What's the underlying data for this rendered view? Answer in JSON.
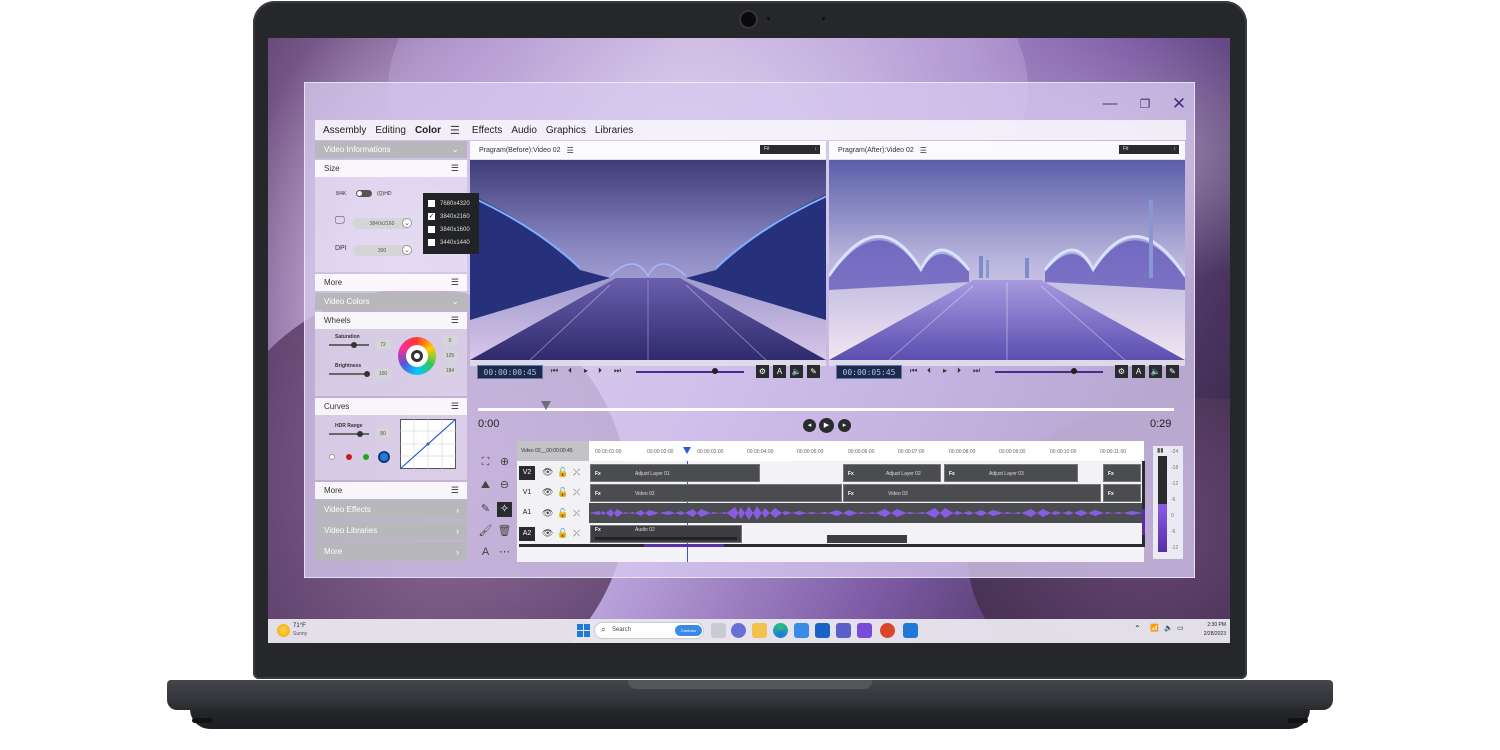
{
  "menu": {
    "items": [
      "Assembly",
      "Editing",
      "Color",
      "Effects",
      "Audio",
      "Graphics",
      "Libraries"
    ],
    "active": "Color"
  },
  "left_panel": {
    "video_informations": "Video Informations",
    "size": "Size",
    "toggle_left": "8/4K",
    "toggle_right": "(Q)HD",
    "resolution_value": "3840x2160",
    "dpi_label": "DPI",
    "dpi_value": "300",
    "resolutions": [
      "7680x4320",
      "3840x2160",
      "3840x1600",
      "3440x1440"
    ],
    "resolution_checked": "3840x2160",
    "more_1": "More",
    "video_colors": "Video Colors",
    "wheels": "Wheels",
    "saturation_label": "Saturation",
    "saturation_value": "72",
    "brightness_label": "Brightness",
    "brightness_value": "100",
    "wheel_values": [
      "0",
      "125",
      "184"
    ],
    "curves": "Curves",
    "hdr_label": "HDR Range",
    "hdr_value": "80",
    "more_2": "More",
    "video_effects": "Video Effects",
    "video_libraries": "Video Libraries",
    "more_3": "More"
  },
  "monitors": {
    "before": {
      "title": "Pragram(Before):Video 02",
      "fit": "Fit",
      "timecode": "00:00:00:45"
    },
    "after": {
      "title": "Pragram(After):Video 02",
      "fit": "Fit",
      "timecode": "00:00:05:45"
    }
  },
  "transport": {
    "start": "0:00",
    "end": "0:29",
    "scrub_fraction": 0.1
  },
  "timeline": {
    "header": "Video 02__00:00:00:45",
    "ruler": [
      "00:00:01:00",
      "00:00:02:00",
      "00:00:03:00",
      "00:00:04:00",
      "00:00:05:00",
      "00:00:06:00",
      "00:00:07:00",
      "00:00:08:00",
      "00:00:09:00",
      "00:00:10:00",
      "00:00:11:00"
    ],
    "tracks": [
      "V2",
      "V1",
      "A1",
      "A2"
    ],
    "clip_fx": "Fx",
    "clips": {
      "adjust_1": "Adjust Layer 01",
      "adjust_2": "Adjust Layer 02",
      "adjust_3": "Adjust Layer 03",
      "video_02": "Video 02",
      "video_03": "Video 03",
      "audio_02": "Audio 02"
    },
    "meter_scale": [
      "-24",
      "-18",
      "-12",
      "-6",
      "0",
      "-6",
      "-12"
    ]
  },
  "taskbar": {
    "temperature": "71°F",
    "weather": "Sunny",
    "search_placeholder": "Search",
    "contoso": "Contoso",
    "time": "2:30 PM",
    "date": "2/28/2023"
  },
  "colors": {
    "accent": "#5a2ea6",
    "timecode_bg": "#1e2a46"
  }
}
